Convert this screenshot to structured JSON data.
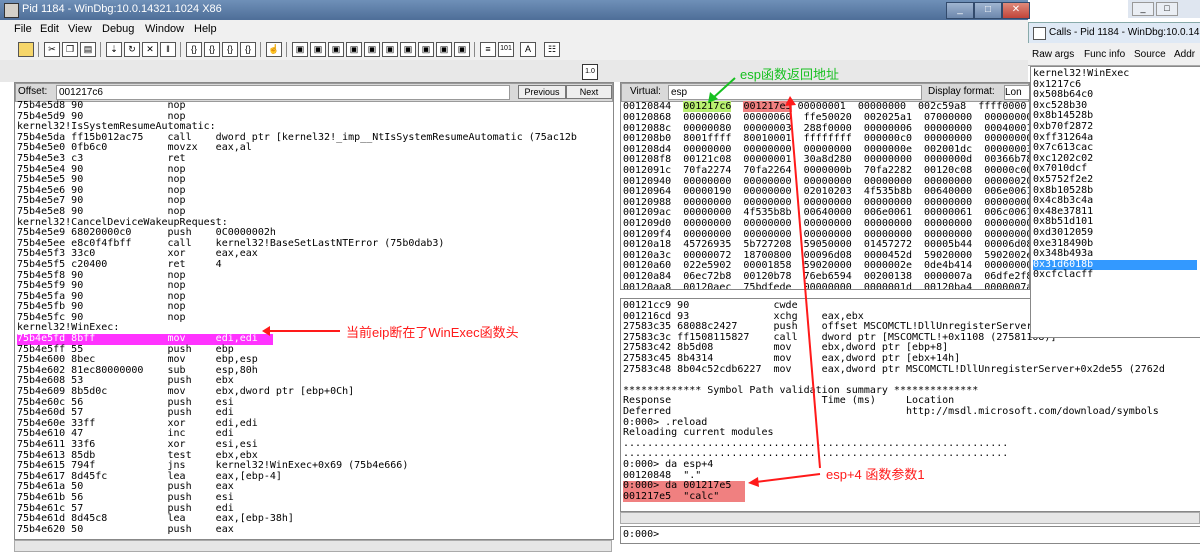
{
  "window": {
    "title": "Pid 1184 - WinDbg:10.0.14321.1024 X86",
    "controls": [
      "_",
      "□",
      "✕"
    ]
  },
  "menubar": [
    "File",
    "Edit",
    "View",
    "Debug",
    "Window",
    "Help"
  ],
  "disasm": {
    "offset_label": "Offset:",
    "offset_value": "001217c6",
    "prev_button": "Previous",
    "next_button": "Next",
    "lines": [
      "75b4e5d8 90              nop",
      "75b4e5d9 90              nop",
      "kernel32!IsSystemResumeAutomatic:",
      "75b4e5da ff15b012ac75    call    dword ptr [kernel32!_imp__NtIsSystemResumeAutomatic (75ac12b",
      "75b4e5e0 0fb6c0          movzx   eax,al",
      "75b4e5e3 c3              ret",
      "75b4e5e4 90              nop",
      "75b4e5e5 90              nop",
      "75b4e5e6 90              nop",
      "75b4e5e7 90              nop",
      "75b4e5e8 90              nop",
      "kernel32!CancelDeviceWakeupRequest:",
      "75b4e5e9 68020000c0      push    0C0000002h",
      "75b4e5ee e8c0f4fbff      call    kernel32!BaseSetLastNTError (75b0dab3)",
      "75b4e5f3 33c0            xor     eax,eax",
      "75b4e5f5 c20400          ret     4",
      "75b4e5f8 90              nop",
      "75b4e5f9 90              nop",
      "75b4e5fa 90              nop",
      "75b4e5fb 90              nop",
      "75b4e5fc 90              nop",
      "kernel32!WinExec:"
    ],
    "highlight_line": "75b4e5fd 8bff            mov     edi,edi",
    "lines_after": [
      "75b4e5ff 55              push    ebp",
      "75b4e600 8bec            mov     ebp,esp",
      "75b4e602 81ec80000000    sub     esp,80h",
      "75b4e608 53              push    ebx",
      "75b4e609 8b5d0c          mov     ebx,dword ptr [ebp+0Ch]",
      "75b4e60c 56              push    esi",
      "75b4e60d 57              push    edi",
      "75b4e60e 33ff            xor     edi,edi",
      "75b4e610 47              inc     edi",
      "75b4e611 33f6            xor     esi,esi",
      "75b4e613 85db            test    ebx,ebx",
      "75b4e615 794f            jns     kernel32!WinExec+0x69 (75b4e666)",
      "75b4e617 8d45fc          lea     eax,[ebp-4]",
      "75b4e61a 50              push    eax",
      "75b4e61b 56              push    esi",
      "75b4e61c 57              push    edi",
      "75b4e61d 8d45c8          lea     eax,[ebp-38h]",
      "75b4e620 50              push    eax"
    ]
  },
  "memory": {
    "virtual_label": "Virtual:",
    "virtual_value": "esp",
    "display_format_label": "Display format:",
    "display_format_value": "Lon",
    "first_row_addr": "00120844",
    "first_row_ret": "001217c6",
    "first_row_arg": "001217e5",
    "first_row_rest": " 00000001  00000000  002c59a8  ffff0000",
    "rows": [
      "00120868  00000060  00000060  ffe50020  002025a1  07000000  00000000",
      "0012088c  00000080  00000003  288f0000  00000006  00000000  00040001",
      "001208b0  8001ffff  80010001  ffffffff  000000c0  00000000  00000000",
      "001208d4  00000000  00000000  00000000  0000000e  002001dc  00000003",
      "001208f8  00121c08  00000001  30a8d280  00000000  0000000d  00366b78",
      "0012091c  70fa2274  70fa2264  0000000b  70fa2282  00120c08  00000c00",
      "00120940  00000000  00000000  00000000  00000000  00000000  00000020",
      "00120964  00000190  00000000  02010203  4f535b8b  00640000  006e0061",
      "00120988  00000000  00000000  00000000  00000000  00000000  00000000",
      "001209ac  00000000  4f535b8b  00640000  006e0061  00000061  006c0061",
      "001209d0  00000000  00000000  00000000  00000000  00000000  00000000",
      "001209f4  00000000  00000000  00000000  00000000  00000000  00000000",
      "00120a18  45726935  5b727208  59050000  01457272  00005b44  00006d08",
      "00120a3c  00000072  18700800  00096d08  0000452d  59020000  5902002e",
      "00120a60  022e5902  00001858  59020000  0000002e  0de4b414  00000000",
      "00120a84  06ec72b8  00120b78  76eb6594  00200138  0000007a  06dfe2f8",
      "00120aa8  00120aec  75bdfede  00000000  0000001d  00120ba4  0000007a"
    ]
  },
  "command": {
    "lines_top": [
      "00121cc9 90              cwde",
      "001216cd 93              xchg    eax,ebx",
      "27583c35 68088c2427      push    offset MSCOMCTL!DllUnregisterServer",
      "27583c3c ff1508115827    call    dword ptr [MSCOMCTL!+0x1108 (27581108)]",
      "27583c42 8b5d08          mov     ebx,dword ptr [ebp+8]",
      "27583c45 8b4314          mov     eax,dword ptr [ebx+14h]",
      "27583c48 8b04c52cdb6227  mov     eax,dword ptr MSCOMCTL!DllUnregisterServer+0x2de55 (2762d",
      "",
      "************* Symbol Path validation summary **************",
      "Response                         Time (ms)     Location",
      "Deferred                                       http://msdl.microsoft.com/download/symbols",
      "0:000> .reload",
      "Reloading current modules",
      "................................................................",
      "................................................................",
      "0:000> da esp+4",
      "00120848  \".\""
    ],
    "hl_line1": "0:000> da 001217e5",
    "hl_line2": "001217e5  \"calc\"",
    "prompt": "0:000>"
  },
  "calls": {
    "title": "Calls - Pid 1184 - WinDbg:10.0.14",
    "buttons": [
      "Raw args",
      "Func info",
      "Source",
      "Addr"
    ],
    "items": [
      "kernel32!WinExec",
      "0x1217c6",
      "0x508b64c0",
      "0xc528b30",
      "0x8b14528b",
      "0xb70f2872",
      "0xff31264a",
      "0x7c613cac",
      "0xc1202c02",
      "0x7010dcf",
      "0x5752f2e2",
      "0x8b10528b",
      "0x4c8b3c4a",
      "0x48e37811",
      "0x8b51d101",
      "0xd3012059",
      "0xe318490b",
      "0x348b493a",
      "0x31d6018b",
      "0xcfclacff"
    ],
    "selected_index": 18
  },
  "annotations": {
    "eip": "当前eip断在了WinExec函数头",
    "ret_addr": "esp函数返回地址",
    "arg1": "esp+4  函数参数1"
  },
  "colors": {
    "eip_highlight": "#ff33ff",
    "ret_highlight": "#b8f070",
    "arg_highlight": "#f08080",
    "annotation_red": "#ff1a1a",
    "annotation_green": "#17c020",
    "calls_selected": "#3399ff"
  }
}
